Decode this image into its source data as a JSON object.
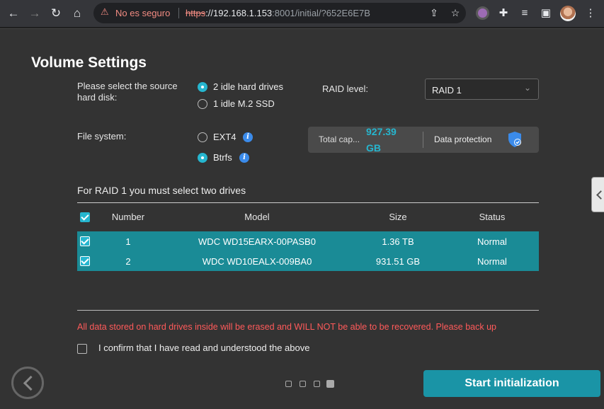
{
  "browser": {
    "security_label": "No es seguro",
    "url_scheme": "https",
    "url_host": "://192.168.1.153",
    "url_rest": ":8001/initial/?652E6E7B"
  },
  "page": {
    "title": "Volume Settings",
    "source_label": "Please select the source hard disk:",
    "source_options": [
      {
        "label": "2 idle hard drives",
        "selected": true
      },
      {
        "label": "1 idle M.2 SSD",
        "selected": false
      }
    ],
    "raid_label": "RAID level:",
    "raid_value": "RAID 1",
    "fs_label": "File system:",
    "fs_options": [
      {
        "label": "EXT4",
        "selected": false
      },
      {
        "label": "Btrfs",
        "selected": true
      }
    ],
    "capacity_label": "Total cap...",
    "capacity_value": "927.39 GB",
    "protection_label": "Data protection",
    "section_title": "For RAID 1 you must select two drives",
    "table": {
      "headers": [
        "Number",
        "Model",
        "Size",
        "Status"
      ],
      "rows": [
        {
          "number": "1",
          "model": "WDC WD15EARX-00PASB0",
          "size": "1.36 TB",
          "status": "Normal",
          "checked": true
        },
        {
          "number": "2",
          "model": "WDC WD10EALX-009BA0",
          "size": "931.51 GB",
          "status": "Normal",
          "checked": true
        }
      ]
    },
    "warning": "All data stored on hard drives inside will be erased and WILL NOT be able to be recovered. Please back up",
    "confirm_label": "I confirm that I have read and understood the above",
    "start_button": "Start initialization",
    "pager": {
      "total": 4,
      "active": 4
    }
  },
  "colors": {
    "accent": "#26b6cf",
    "row_highlight": "#1a8b96",
    "warning": "#ff5a5a",
    "button": "#1a94a6"
  }
}
